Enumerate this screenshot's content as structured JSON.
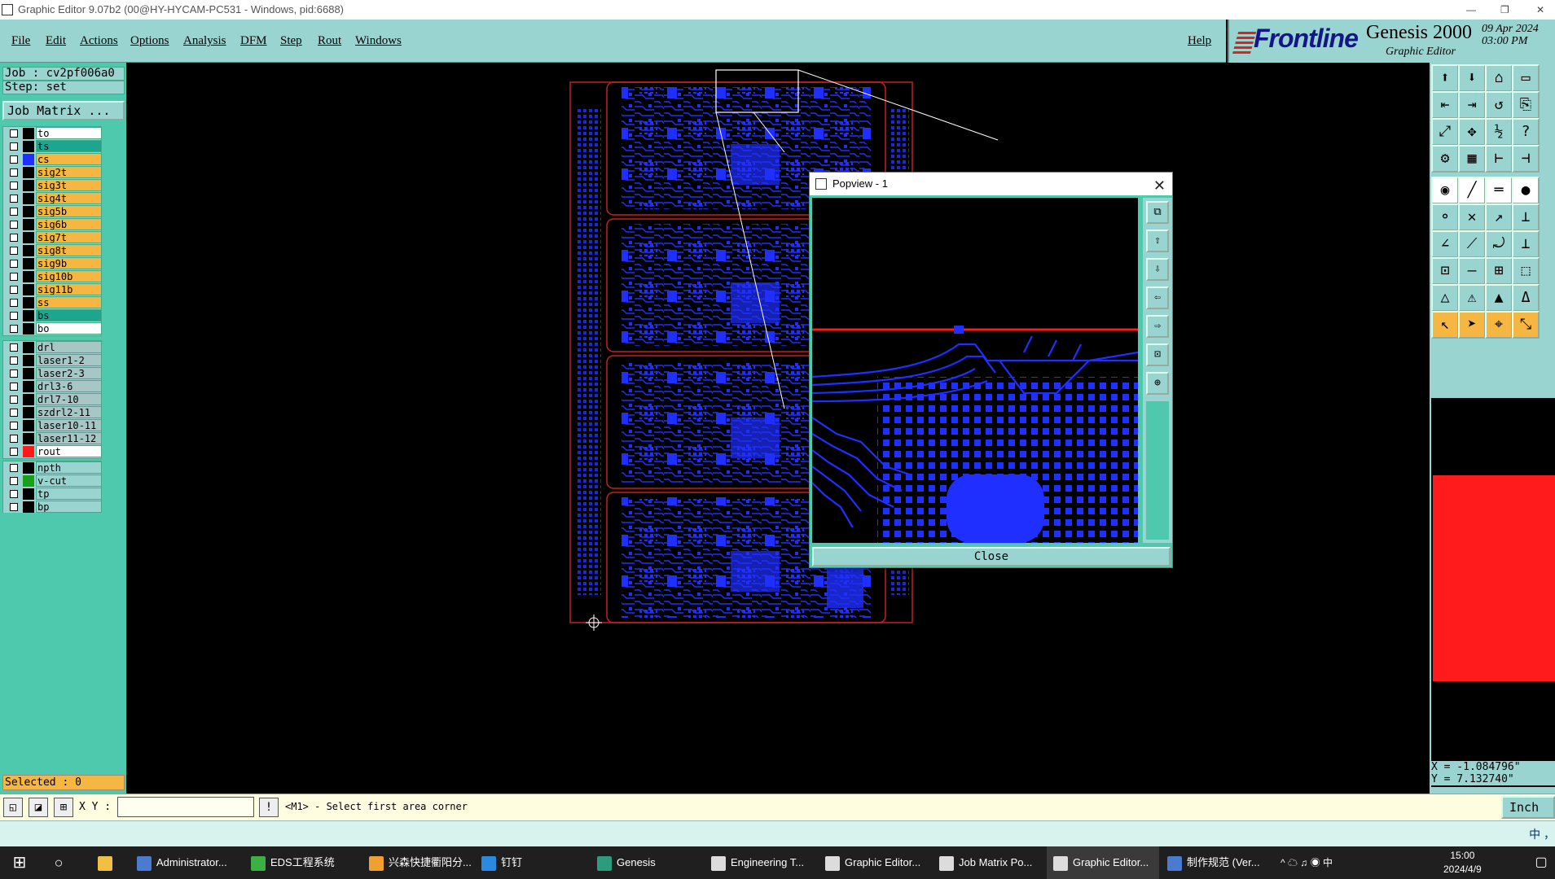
{
  "window": {
    "title": "Graphic Editor 9.07b2 (00@HY-HYCAM-PC531 - Windows, pid:6688)"
  },
  "menu": {
    "items": [
      "File",
      "Edit",
      "Actions",
      "Options",
      "Analysis",
      "DFM",
      "Step",
      "Rout",
      "Windows"
    ],
    "help": "Help"
  },
  "brand": {
    "logo": "Frontline",
    "product": "Genesis 2000",
    "subtitle": "Graphic Editor",
    "date": "09 Apr 2024",
    "time": "03:00 PM"
  },
  "job": {
    "label": "Job : cv2pf006a0",
    "step": "Step: set",
    "matrix_button": "Job Matrix ..."
  },
  "layers": {
    "signal": [
      {
        "name": "to",
        "color": "#ffffff",
        "swatch": "#000000"
      },
      {
        "name": "ts",
        "color": "#1ea58f",
        "swatch": "#000000"
      },
      {
        "name": "cs",
        "color": "#f5b642",
        "swatch": "#1f2fff"
      },
      {
        "name": "sig2t",
        "color": "#f5b642",
        "swatch": "#000000"
      },
      {
        "name": "sig3t",
        "color": "#f5b642",
        "swatch": "#000000"
      },
      {
        "name": "sig4t",
        "color": "#f5b642",
        "swatch": "#000000"
      },
      {
        "name": "sig5b",
        "color": "#f5b642",
        "swatch": "#000000"
      },
      {
        "name": "sig6b",
        "color": "#f5b642",
        "swatch": "#000000"
      },
      {
        "name": "sig7t",
        "color": "#f5b642",
        "swatch": "#000000"
      },
      {
        "name": "sig8t",
        "color": "#f5b642",
        "swatch": "#000000"
      },
      {
        "name": "sig9b",
        "color": "#f5b642",
        "swatch": "#000000"
      },
      {
        "name": "sig10b",
        "color": "#f5b642",
        "swatch": "#000000"
      },
      {
        "name": "sig11b",
        "color": "#f5b642",
        "swatch": "#000000"
      },
      {
        "name": "ss",
        "color": "#f5b642",
        "swatch": "#000000"
      },
      {
        "name": "bs",
        "color": "#1ea58f",
        "swatch": "#000000"
      },
      {
        "name": "bo",
        "color": "#ffffff",
        "swatch": "#000000"
      }
    ],
    "drill": [
      {
        "name": "drl",
        "color": "#a7c7c7",
        "swatch": "#000000"
      },
      {
        "name": "laser1-2",
        "color": "#a7c7c7",
        "swatch": "#000000"
      },
      {
        "name": "laser2-3",
        "color": "#a7c7c7",
        "swatch": "#000000"
      },
      {
        "name": "drl3-6",
        "color": "#a7c7c7",
        "swatch": "#000000"
      },
      {
        "name": "drl7-10",
        "color": "#a7c7c7",
        "swatch": "#000000"
      },
      {
        "name": "szdrl2-11",
        "color": "#a7c7c7",
        "swatch": "#000000"
      },
      {
        "name": "laser10-11",
        "color": "#a7c7c7",
        "swatch": "#000000"
      },
      {
        "name": "laser11-12",
        "color": "#a7c7c7",
        "swatch": "#000000"
      },
      {
        "name": "rout",
        "color": "#ffffff",
        "swatch": "#ff1b1b"
      }
    ],
    "other": [
      {
        "name": "npth",
        "color": "#9ad4d0",
        "swatch": "#000000"
      },
      {
        "name": "v-cut",
        "color": "#9ad4d0",
        "swatch": "#18a018"
      },
      {
        "name": "tp",
        "color": "#9ad4d0",
        "swatch": "#000000"
      },
      {
        "name": "bp",
        "color": "#9ad4d0",
        "swatch": "#000000"
      }
    ]
  },
  "status": {
    "selected": "Selected : 0",
    "x": "X = -1.084796\"",
    "y": "Y = 7.132740\""
  },
  "command": {
    "xy_label": "X Y :",
    "xy_value": "",
    "message": "<M1> - Select first area corner",
    "unit": "Inch"
  },
  "popview": {
    "title": "Popview - 1",
    "close": "Close"
  },
  "toolbar": {
    "icons": [
      "save-icon",
      "save-as-icon",
      "home-icon",
      "window-icon",
      "undo-icon",
      "redo-icon",
      "zoom-back-icon",
      "script-icon",
      "fit-icon",
      "center-icon",
      "scale-1to2-icon",
      "help-icon",
      "settings-icon",
      "grid-icon",
      "measure-icon",
      "snap-icon",
      "pad-icon",
      "line-icon",
      "ruler-icon",
      "dot-icon",
      "connect-icon",
      "delete-icon",
      "move-icon",
      "route-icon",
      "angle-icon",
      "slope-icon",
      "arc-icon",
      "step-icon",
      "feature-icon",
      "minus-icon",
      "resize-icon",
      "shape-icon",
      "warning-icon",
      "alert-icon",
      "caution-icon",
      "delta-icon",
      "pointer-icon",
      "select-icon",
      "lasso-icon",
      "zoom-select-icon"
    ]
  },
  "taskbar": {
    "items": [
      "Administrator...",
      "EDS工程系统",
      "兴森快捷衢阳分...",
      "钉钉",
      "Genesis",
      "Engineering T...",
      "Graphic Editor...",
      "Job Matrix Po...",
      "Graphic Editor...",
      "制作规范 (Ver..."
    ],
    "time": "15:00",
    "date": "2024/4/9",
    "tray": "中"
  },
  "ime": {
    "text": "中 ，"
  }
}
